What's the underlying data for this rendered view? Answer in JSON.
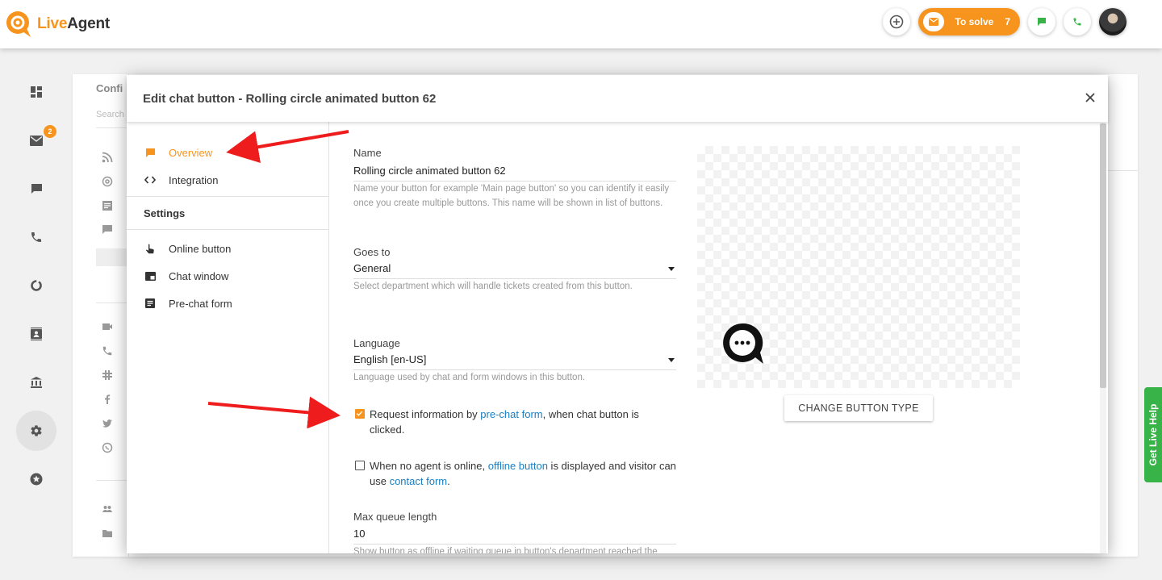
{
  "app": {
    "logo_text_live": "Live",
    "logo_text_agent": "Agent"
  },
  "topbar": {
    "solve_label": "To solve",
    "solve_count": "7"
  },
  "leftnav": {
    "mail_badge": "2"
  },
  "background": {
    "title": "Confi",
    "search_placeholder": "Search"
  },
  "modal": {
    "title": "Edit chat button - Rolling circle animated button 62",
    "sidebar": {
      "overview": "Overview",
      "integration": "Integration",
      "settings_header": "Settings",
      "online_button": "Online button",
      "chat_window": "Chat window",
      "prechat_form": "Pre-chat form"
    },
    "form": {
      "name_label": "Name",
      "name_value": "Rolling circle animated button 62",
      "name_help": "Name your button for example 'Main page button' so you can identify it easily once you create multiple buttons. This name will be shown in list of buttons.",
      "goes_to_label": "Goes to",
      "goes_to_value": "General",
      "goes_to_help": "Select department which will handle tickets created from this button.",
      "language_label": "Language",
      "language_value": "English [en-US]",
      "language_help": "Language used by chat and form windows in this button.",
      "prechat_check": {
        "checked": true,
        "text_before": "Request information by ",
        "link": "pre-chat form",
        "text_after": ", when chat button is clicked."
      },
      "offline_check": {
        "checked": false,
        "text_before": "When no agent is online, ",
        "link1": "offline button",
        "text_middle": " is displayed and visitor can use ",
        "link2": "contact form",
        "text_after": "."
      },
      "queue_label": "Max queue length",
      "queue_value": "10",
      "queue_help": "Show button as offline if waiting queue in button's department reached the"
    },
    "preview": {
      "change_button_label": "CHANGE BUTTON TYPE"
    }
  },
  "help_tab": {
    "label": "Get Live Help"
  },
  "colors": {
    "accent": "#f7941d",
    "link": "#1a7fc1",
    "help_green": "#37b347",
    "arrow_red": "#ee1c1c"
  }
}
